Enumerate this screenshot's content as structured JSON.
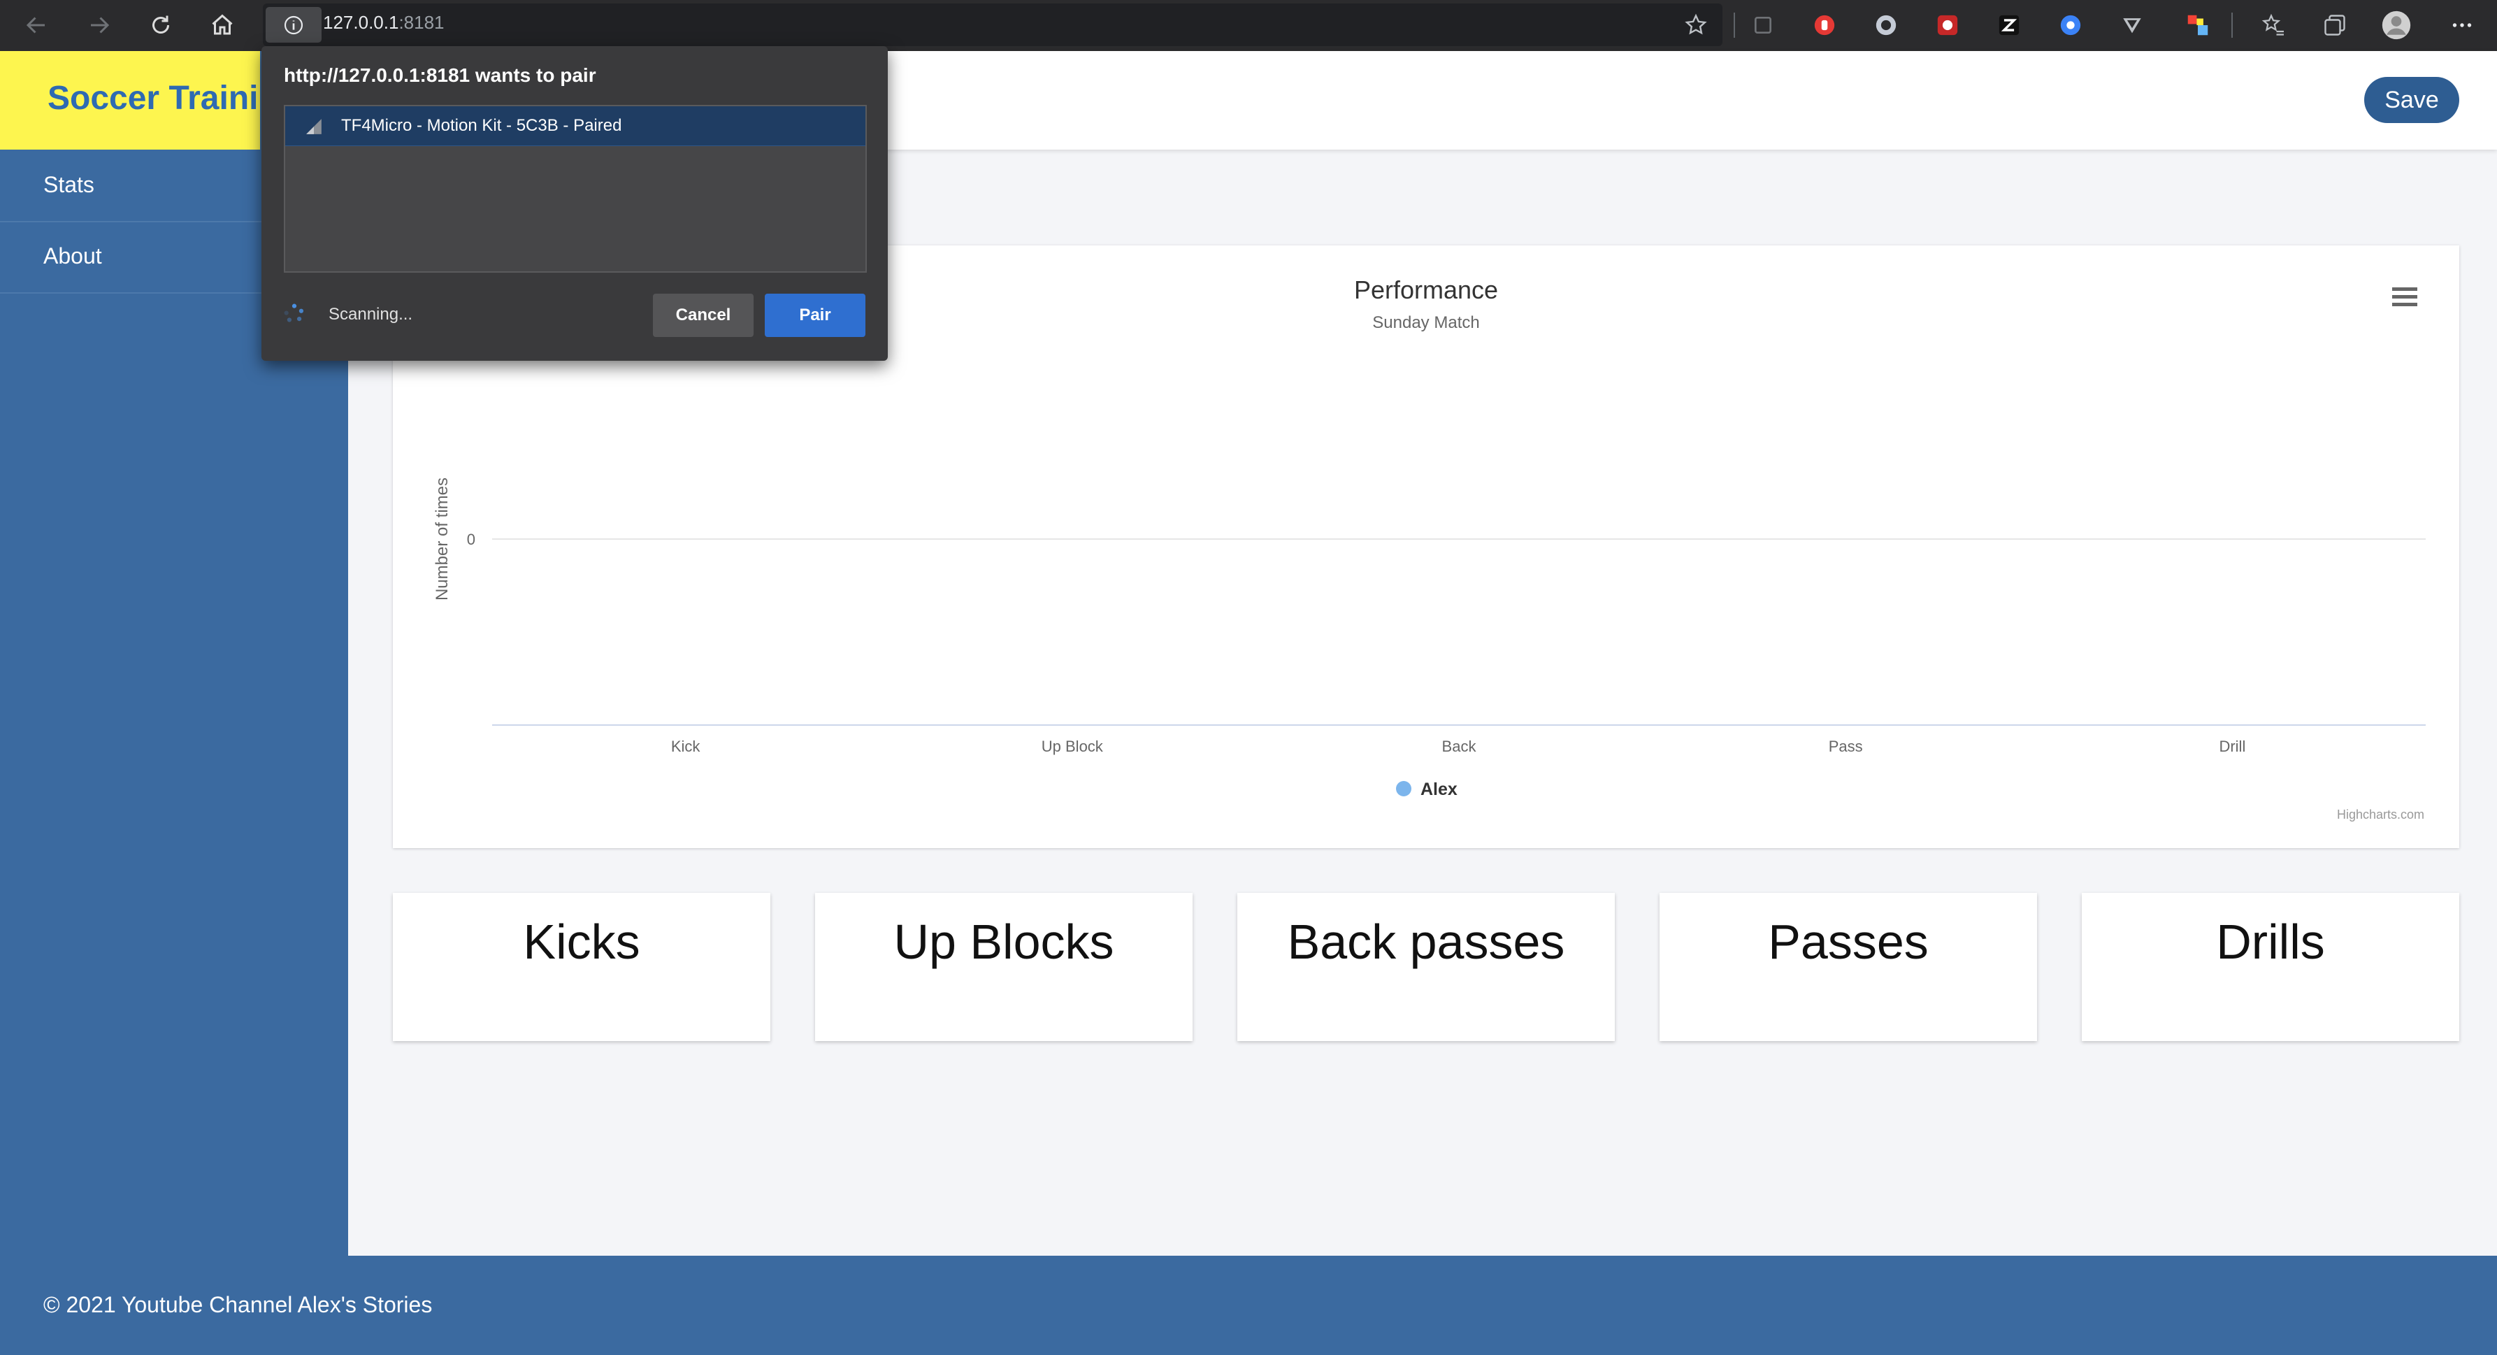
{
  "browser": {
    "url_host": "127.0.0.1",
    "url_port": ":8181"
  },
  "app": {
    "brand": "Soccer Training",
    "save_label": "Save",
    "accent": "#3b6aa0",
    "brand_bg": "#fdf54f"
  },
  "sidebar": {
    "items": [
      {
        "label": "Stats"
      },
      {
        "label": "About"
      }
    ]
  },
  "cards": [
    {
      "label": "Kicks"
    },
    {
      "label": "Up Blocks"
    },
    {
      "label": "Back passes"
    },
    {
      "label": "Passes"
    },
    {
      "label": "Drills"
    }
  ],
  "footer": {
    "text": "© 2021 Youtube Channel Alex's Stories"
  },
  "popup": {
    "title": "http://127.0.0.1:8181 wants to pair",
    "device": "TF4Micro - Motion Kit - 5C3B - Paired",
    "status": "Scanning...",
    "cancel_label": "Cancel",
    "pair_label": "Pair"
  },
  "chart_data": {
    "type": "bar",
    "title": "Performance",
    "subtitle": "Sunday Match",
    "ylabel": "Number of times",
    "xlabel": "",
    "categories": [
      "Kick",
      "Up Block",
      "Back",
      "Pass",
      "Drill"
    ],
    "series": [
      {
        "name": "Alex",
        "values": [],
        "color": "#7cb5ec"
      }
    ],
    "y_ticks": [
      "0"
    ],
    "legend": "bottom-center",
    "credits": "Highcharts.com",
    "grid": true
  }
}
